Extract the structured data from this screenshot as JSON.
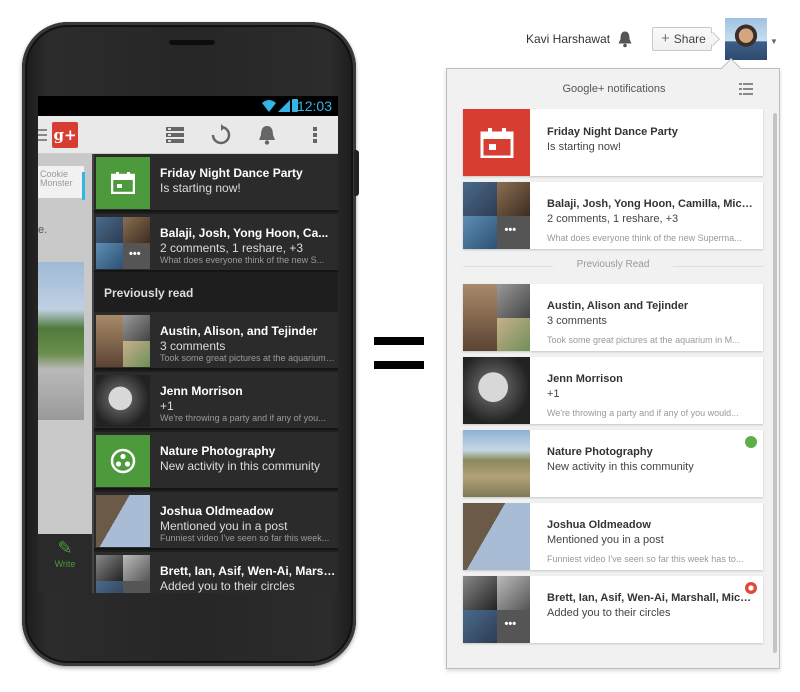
{
  "phone": {
    "status_time": "12:03",
    "bg_card_text": "Cookie\nMonster",
    "bg_dot_text": "e.",
    "bg_comment_count": "3",
    "write_label": "Write",
    "section_label": "Previously read",
    "items": [
      {
        "title": "Friday Night Dance Party",
        "subtitle": "Is starting now!",
        "snippet": ""
      },
      {
        "title": "Balaji, Josh, Yong Hoon, Ca...",
        "subtitle": "2 comments, 1 reshare, +3",
        "snippet": "What does everyone think of the new S..."
      },
      {
        "title": "Austin, Alison, and Tejinder",
        "subtitle": "3 comments",
        "snippet": "Took some great pictures at the aquarium i..."
      },
      {
        "title": "Jenn Morrison",
        "subtitle": "+1",
        "snippet": "We're throwing a party and if any of you..."
      },
      {
        "title": "Nature Photography",
        "subtitle": "New activity in this community",
        "snippet": ""
      },
      {
        "title": "Joshua Oldmeadow",
        "subtitle": "Mentioned you in a post",
        "snippet": "Funniest video I've seen so far this week..."
      },
      {
        "title": "Brett, Ian, Asif, Wen-Ai, Marsh...",
        "subtitle": "Added you to their circles",
        "snippet": ""
      }
    ]
  },
  "desktop": {
    "user_name": "Kavi Harshawat",
    "share_label": "Share",
    "panel_title": "Google+ notifications",
    "section_label": "Previously Read",
    "items": [
      {
        "title": "Friday Night Dance Party",
        "subtitle": "Is starting now!",
        "snippet": ""
      },
      {
        "title": "Balaji, Josh, Yong Hoon, Camilla, Mich...",
        "subtitle": "2 comments, 1 reshare, +3",
        "snippet": "What does everyone think of the new Superma..."
      },
      {
        "title": "Austin, Alison and Tejinder",
        "subtitle": "3 comments",
        "snippet": "Took some great pictures at the aquarium in M..."
      },
      {
        "title": "Jenn Morrison",
        "subtitle": "+1",
        "snippet": "We're throwing a party and if any of you would..."
      },
      {
        "title": "Nature Photography",
        "subtitle": "New activity in this community",
        "snippet": ""
      },
      {
        "title": "Joshua Oldmeadow",
        "subtitle": "Mentioned you in a post",
        "snippet": "Funniest video I've seen so far this week has to..."
      },
      {
        "title": "Brett, Ian, Asif, Wen-Ai, Marshall, Mich...",
        "subtitle": "Added you to their circles",
        "snippet": ""
      }
    ]
  },
  "colors": {
    "gplus_red": "#d73d32",
    "event_green": "#4c9a3b",
    "holo_blue": "#33b5e5"
  },
  "icons": [
    "wifi-icon",
    "signal-icon",
    "battery-icon",
    "menu-icon",
    "gplus-logo",
    "stream-list-icon",
    "refresh-icon",
    "bell-icon",
    "overflow-icon",
    "calendar-icon",
    "community-icon",
    "pencil-icon",
    "plus-icon",
    "list-icon",
    "circles-badge-icon",
    "community-badge-icon"
  ]
}
